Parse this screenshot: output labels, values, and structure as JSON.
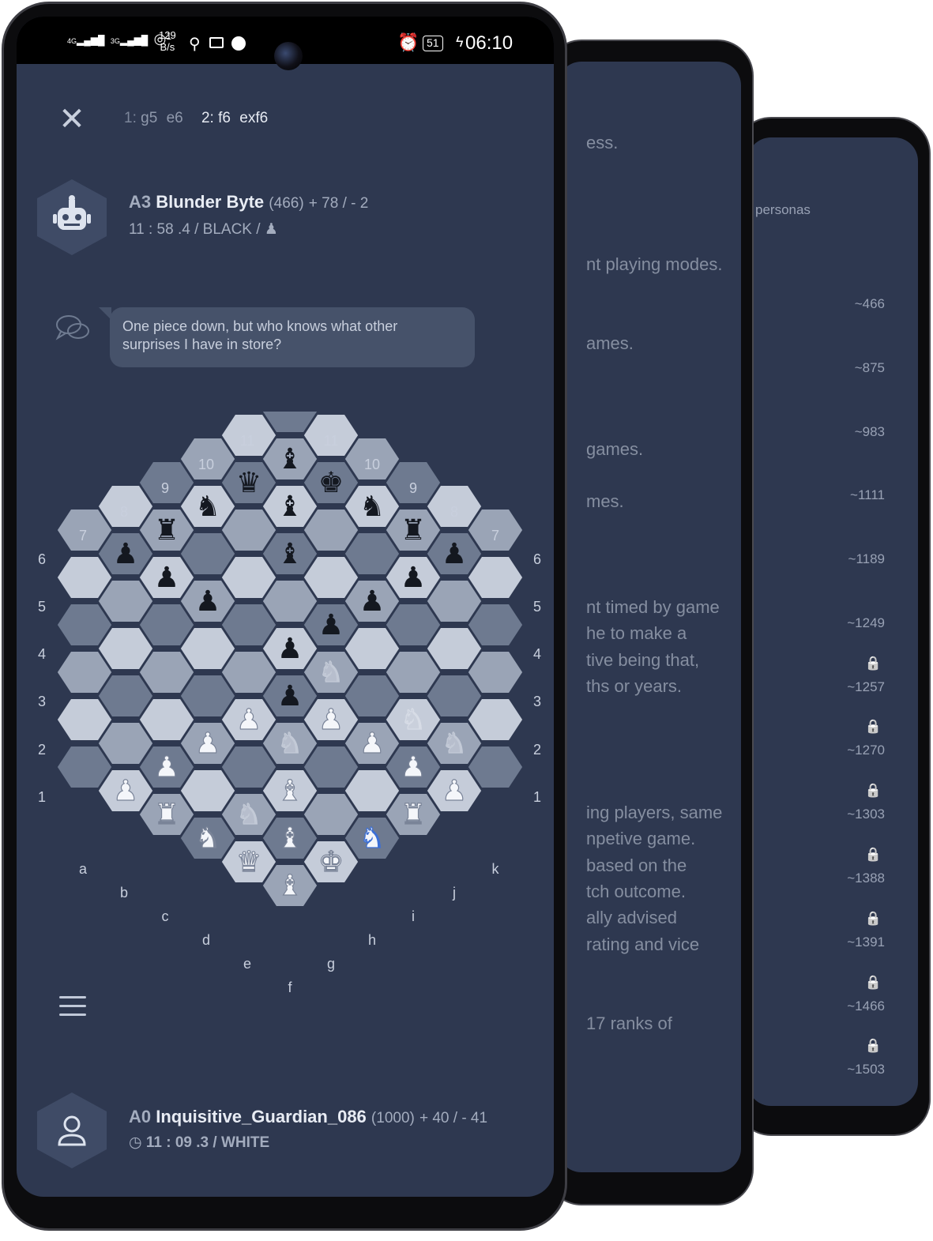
{
  "statusbar": {
    "net1": "4G",
    "net2": "3G",
    "hotspot_count": "1",
    "speed": "129",
    "speed_unit": "B/s",
    "battery": "51",
    "time": "06:10"
  },
  "moves": {
    "m1_num": "1:",
    "m1_white": "g5",
    "m1_black": "e6",
    "m2_num": "2:",
    "m2_white": "f6",
    "m2_black": "exf6"
  },
  "opponent": {
    "rank": "A3",
    "name": "Blunder Byte",
    "rating": "(466)",
    "record": "+ 78 / - 2",
    "clock": "11 : 58 .4",
    "color": "/ BLACK",
    "pawn_label": "/"
  },
  "chat": {
    "message": "One piece down, but who knows what other surprises I have in store?"
  },
  "player": {
    "rank": "A0",
    "name": "Inquisitive_Guardian_086",
    "rating": "(1000)",
    "record": "+ 40 / - 41",
    "clock": "11 : 09 .3",
    "color": "/ WHITE"
  },
  "board": {
    "files": [
      "a",
      "b",
      "c",
      "d",
      "e",
      "f",
      "g",
      "h",
      "i",
      "k",
      "j"
    ],
    "left_ranks": [
      "1",
      "2",
      "3",
      "4",
      "5",
      "6",
      "7",
      "8",
      "9",
      "10",
      "11"
    ],
    "right_ranks": [
      "1",
      "2",
      "3",
      "4",
      "5",
      "6",
      "7",
      "8",
      "9",
      "10",
      "11"
    ],
    "pieces": [
      {
        "q": 0,
        "r": -4,
        "glyph": "♝",
        "side": "black"
      },
      {
        "q": 0,
        "r": -3,
        "glyph": "♝",
        "side": "black"
      },
      {
        "q": 0,
        "r": -2,
        "glyph": "♝",
        "side": "black"
      },
      {
        "q": -1,
        "r": -3,
        "glyph": "♛",
        "side": "black"
      },
      {
        "q": 1,
        "r": -4,
        "glyph": "♚",
        "side": "black"
      },
      {
        "q": -2,
        "r": -2,
        "glyph": "♞",
        "side": "black"
      },
      {
        "q": 2,
        "r": -4,
        "glyph": "♞",
        "side": "black"
      },
      {
        "q": -3,
        "r": -1,
        "glyph": "♜",
        "side": "black"
      },
      {
        "q": 3,
        "r": -4,
        "glyph": "♜",
        "side": "black"
      },
      {
        "q": -4,
        "r": 0,
        "glyph": "♟",
        "side": "black"
      },
      {
        "q": -3,
        "r": 0,
        "glyph": "♟",
        "side": "black"
      },
      {
        "q": -2,
        "r": 0,
        "glyph": "♟",
        "side": "black"
      },
      {
        "q": 2,
        "r": -2,
        "glyph": "♟",
        "side": "black"
      },
      {
        "q": 3,
        "r": -3,
        "glyph": "♟",
        "side": "black"
      },
      {
        "q": 4,
        "r": -4,
        "glyph": "♟",
        "side": "black"
      },
      {
        "q": 0,
        "r": 0,
        "glyph": "♟",
        "side": "black"
      },
      {
        "q": 0,
        "r": 1,
        "glyph": "♟",
        "side": "black"
      },
      {
        "q": 1,
        "r": -1,
        "glyph": "♟",
        "side": "black"
      },
      {
        "q": 0,
        "r": 5,
        "glyph": "♝",
        "side": "white"
      },
      {
        "q": 0,
        "r": 4,
        "glyph": "♝",
        "side": "white"
      },
      {
        "q": 0,
        "r": 3,
        "glyph": "♝",
        "side": "white"
      },
      {
        "q": -1,
        "r": 5,
        "glyph": "♛",
        "side": "white"
      },
      {
        "q": 1,
        "r": 4,
        "glyph": "♚",
        "side": "white"
      },
      {
        "q": -2,
        "r": 5,
        "glyph": "♞",
        "side": "white"
      },
      {
        "q": 2,
        "r": 3,
        "glyph": "♞",
        "side": "highlight"
      },
      {
        "q": -3,
        "r": 5,
        "glyph": "♜",
        "side": "white"
      },
      {
        "q": 3,
        "r": 2,
        "glyph": "♜",
        "side": "white"
      },
      {
        "q": -4,
        "r": 5,
        "glyph": "♟",
        "side": "white"
      },
      {
        "q": -3,
        "r": 4,
        "glyph": "♟",
        "side": "white"
      },
      {
        "q": -2,
        "r": 3,
        "glyph": "♟",
        "side": "white"
      },
      {
        "q": -1,
        "r": 2,
        "glyph": "♟",
        "side": "white"
      },
      {
        "q": 1,
        "r": 1,
        "glyph": "♟",
        "side": "white"
      },
      {
        "q": 2,
        "r": 1,
        "glyph": "♟",
        "side": "white"
      },
      {
        "q": 3,
        "r": 1,
        "glyph": "♟",
        "side": "white"
      },
      {
        "q": 4,
        "r": 1,
        "glyph": "♟",
        "side": "white"
      },
      {
        "q": 0,
        "r": 2,
        "glyph": "♞",
        "side": "ghost"
      },
      {
        "q": 1,
        "r": 1,
        "glyph": "♞",
        "side": "none"
      },
      {
        "q": -1,
        "r": 4,
        "glyph": "♞",
        "side": "ghost"
      },
      {
        "q": 3,
        "r": 0,
        "glyph": "♞",
        "side": "ghost"
      },
      {
        "q": 4,
        "r": 0,
        "glyph": "♞",
        "side": "ghost"
      },
      {
        "q": 1,
        "r": 0,
        "glyph": "♞",
        "side": "ghost"
      }
    ]
  },
  "phone2": {
    "lines": [
      "ess.",
      "nt playing modes.",
      "ames.",
      "games.",
      "mes.",
      "nt timed by game",
      "he to make a",
      "tive being that,",
      "ths or years.",
      "ing players, same",
      "npetive game.",
      "based on the",
      "tch outcome.",
      "ally advised",
      "rating and vice",
      "17 ranks of"
    ]
  },
  "phone3": {
    "header": "personas",
    "ratings": [
      "~466",
      "~875",
      "~983",
      "~1111",
      "~1189",
      "~1249",
      "~1257",
      "~1270",
      "~1303",
      "~1388",
      "~1391",
      "~1466",
      "~1503"
    ]
  },
  "colors": {
    "screen_bg": "#2e3850",
    "hex_light": "#c5ccd9",
    "hex_mid": "#9aa4b6",
    "hex_dark": "#6e7a90",
    "highlight_piece": "#3b6fd6"
  }
}
